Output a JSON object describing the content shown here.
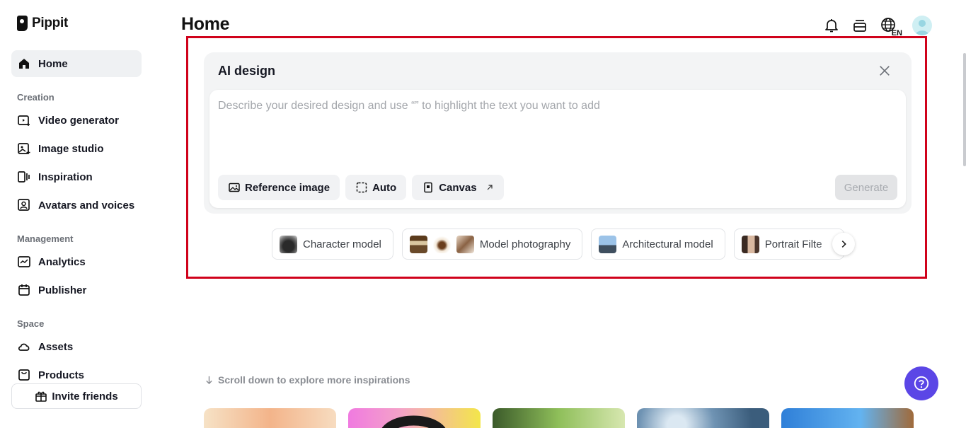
{
  "app": {
    "name": "Pippit"
  },
  "sidebar": {
    "home": "Home",
    "sections": {
      "creation": "Creation",
      "management": "Management",
      "space": "Space"
    },
    "creation_items": [
      "Video generator",
      "Image studio",
      "Inspiration",
      "Avatars and voices"
    ],
    "management_items": [
      "Analytics",
      "Publisher"
    ],
    "space_items": [
      "Assets",
      "Products"
    ],
    "invite": "Invite friends"
  },
  "header": {
    "title": "Home",
    "language": "EN",
    "icons": [
      "bell-icon",
      "subscription-icon",
      "language-icon",
      "avatar"
    ]
  },
  "ai_design": {
    "title": "AI design",
    "placeholder": "Describe your desired design and use “” to highlight the text you want to add",
    "tools": {
      "reference": "Reference image",
      "auto": "Auto",
      "canvas": "Canvas"
    },
    "generate": "Generate"
  },
  "chips": [
    "Character model",
    "Model photography",
    "Architectural model",
    "Portrait Filte"
  ],
  "scroll_hint": "Scroll down to explore more inspirations",
  "colors": {
    "highlight": "#d0021b",
    "help_button": "#5b46e6",
    "active_nav": "#eff1f3"
  }
}
